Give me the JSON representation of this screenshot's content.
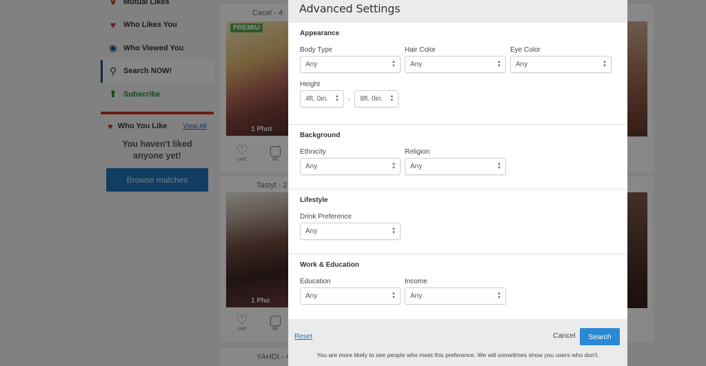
{
  "sidebar": {
    "items": [
      {
        "label": "Mutual Likes",
        "icon": "heart-pair-icon"
      },
      {
        "label": "Who Likes You",
        "icon": "heart-icon"
      },
      {
        "label": "Who Viewed You",
        "icon": "eye-icon"
      },
      {
        "label": "Search NOW!",
        "icon": "search-icon"
      },
      {
        "label": "Subscribe",
        "icon": "arrow-up-circle-icon"
      }
    ],
    "who_you_like": "Who You Like",
    "view_all": "View All",
    "empty_line1": "You haven't liked",
    "empty_line2": "anyone yet!",
    "browse": "Browse matches"
  },
  "cards": {
    "c1_name": "Cecel - 4",
    "c1_badge": "PREMIU",
    "c1_photos": "1 Phot",
    "c2_name": "Tastyt - 2",
    "c2_photos": "1 Pho",
    "c3_name": "YAHDI - 4",
    "like": "LIKE",
    "mes": "ME"
  },
  "modal": {
    "title": "Advanced Settings",
    "appearance": {
      "title": "Appearance",
      "body_type_label": "Body Type",
      "body_type_value": "Any",
      "hair_color_label": "Hair Color",
      "hair_color_value": "Any",
      "eye_color_label": "Eye Color",
      "eye_color_value": "Any",
      "height_label": "Height",
      "height_min": "4ft. 0in.",
      "height_sep": "-",
      "height_max": "8ft. 0in."
    },
    "background": {
      "title": "Background",
      "ethnicity_label": "Ethnicity",
      "ethnicity_value": "Any",
      "religion_label": "Religion",
      "religion_value": "Any"
    },
    "lifestyle": {
      "title": "Lifestyle",
      "drink_label": "Drink Preference",
      "drink_value": "Any"
    },
    "work": {
      "title": "Work & Education",
      "education_label": "Education",
      "education_value": "Any",
      "income_label": "Income",
      "income_value": "Any"
    },
    "footer": {
      "reset": "Reset",
      "cancel": "Cancel",
      "search": "Search",
      "note": "You are more likely to see people who meet this preference. We will sometimes show you users who don't."
    }
  },
  "colors": {
    "accent": "#2b89d4",
    "brand_blue": "#1f6fb5",
    "red": "#c0392b",
    "green": "#1e8a2c"
  }
}
